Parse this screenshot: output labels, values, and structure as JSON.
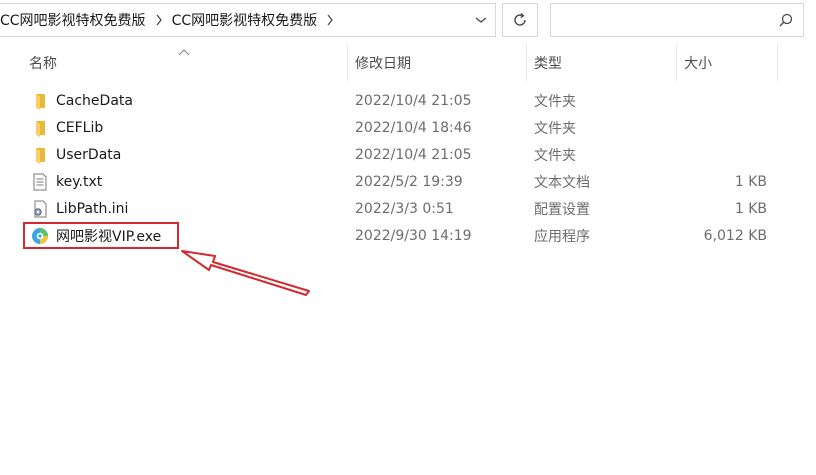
{
  "breadcrumb": [
    "CC网吧影视特权免费版",
    "CC网吧影视特权免费版"
  ],
  "search": {
    "placeholder": "",
    "value": ""
  },
  "columns": {
    "name": "名称",
    "date": "修改日期",
    "type": "类型",
    "size": "大小"
  },
  "files": [
    {
      "icon": "folder-icon",
      "name": "CacheData",
      "date": "2022/10/4 21:05",
      "type": "文件夹",
      "size": ""
    },
    {
      "icon": "folder-icon",
      "name": "CEFLib",
      "date": "2022/10/4 18:46",
      "type": "文件夹",
      "size": ""
    },
    {
      "icon": "folder-icon",
      "name": "UserData",
      "date": "2022/10/4 21:05",
      "type": "文件夹",
      "size": ""
    },
    {
      "icon": "text-file-icon",
      "name": "key.txt",
      "date": "2022/5/2 19:39",
      "type": "文本文档",
      "size": "1 KB"
    },
    {
      "icon": "config-file-icon",
      "name": "LibPath.ini",
      "date": "2022/3/3 0:51",
      "type": "配置设置",
      "size": "1 KB"
    },
    {
      "icon": "app-icon",
      "name": "网吧影视VIP.exe",
      "date": "2022/9/30 14:19",
      "type": "应用程序",
      "size": "6,012 KB"
    }
  ],
  "annotation": {
    "color": "#d6282f",
    "highlighted_file": "网吧影视VIP.exe"
  }
}
